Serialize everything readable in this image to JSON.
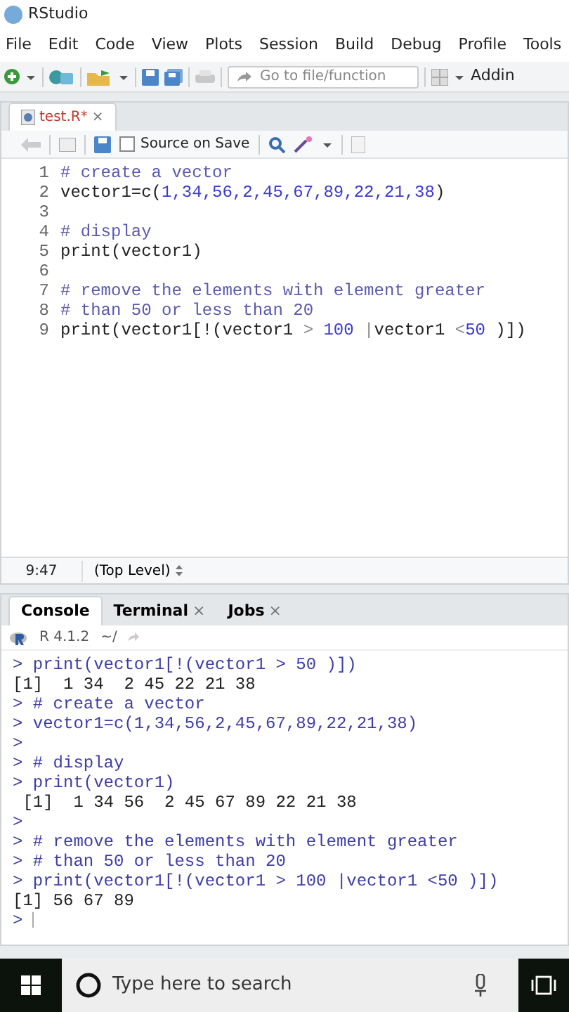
{
  "window": {
    "title": "RStudio"
  },
  "menu": [
    "File",
    "Edit",
    "Code",
    "View",
    "Plots",
    "Session",
    "Build",
    "Debug",
    "Profile",
    "Tools"
  ],
  "toolbar": {
    "goto_placeholder": "Go to file/function",
    "addins": "Addin"
  },
  "editor": {
    "tabs": [
      {
        "label": "test.R*",
        "selected": true,
        "modified": true,
        "close": "×"
      }
    ],
    "source_on_save": {
      "label": "Source on Save",
      "checked": false
    },
    "lines": [
      {
        "number": "1",
        "tokens": [
          {
            "text": "# create a vector",
            "kind": "comment"
          }
        ]
      },
      {
        "number": "2",
        "tokens": [
          {
            "text": "vector1=c(",
            "kind": "plain"
          },
          {
            "text": "1,34,56,2,45,67,89,22,21,38",
            "kind": "number"
          },
          {
            "text": ")",
            "kind": "plain"
          }
        ]
      },
      {
        "number": "3"
      },
      {
        "number": "4",
        "tokens": [
          {
            "text": "# display",
            "kind": "comment"
          }
        ]
      },
      {
        "number": "5",
        "tokens": [
          {
            "text": "print(vector1)",
            "kind": "plain"
          }
        ]
      },
      {
        "number": "6"
      },
      {
        "number": "7",
        "tokens": [
          {
            "text": "# remove the elements with element greater",
            "kind": "comment"
          }
        ]
      },
      {
        "number": "8",
        "tokens": [
          {
            "text": "# than 50 or less than 20",
            "kind": "comment"
          }
        ]
      },
      {
        "number": "9",
        "tokens": [
          {
            "text": "print(vector1[!(vector1 ",
            "kind": "plain"
          },
          {
            "text": ">",
            "kind": "op"
          },
          {
            "text": " 100",
            "kind": "number"
          },
          {
            "text": " |",
            "kind": "op"
          },
          {
            "text": "vector1 ",
            "kind": "plain"
          },
          {
            "text": "<",
            "kind": "op"
          },
          {
            "text": "50",
            "kind": "number"
          },
          {
            "text": " )])",
            "kind": "plain"
          }
        ]
      }
    ],
    "status": {
      "position": "9:47",
      "scope": "(Top Level)"
    }
  },
  "console": {
    "tabs": [
      {
        "label": "Console",
        "selected": true
      },
      {
        "label": "Terminal",
        "selected": false,
        "close": "×"
      },
      {
        "label": "Jobs",
        "selected": false,
        "close": "×"
      }
    ],
    "version": "R 4.1.2",
    "path": "~/",
    "lines": [
      {
        "text": "> print(vector1[!(vector1 > 50 )])",
        "kind": "input"
      },
      {
        "text": "[1]  1 34  2 45 22 21 38",
        "kind": "output"
      },
      {
        "text": "> # create a vector",
        "kind": "input"
      },
      {
        "text": "> vector1=c(1,34,56,2,45,67,89,22,21,38)",
        "kind": "input"
      },
      {
        "text": ">",
        "kind": "input"
      },
      {
        "text": "> # display",
        "kind": "input"
      },
      {
        "text": "> print(vector1)",
        "kind": "input"
      },
      {
        "text": " [1]  1 34 56  2 45 67 89 22 21 38",
        "kind": "output"
      },
      {
        "text": ">",
        "kind": "input"
      },
      {
        "text": "> # remove the elements with element greater",
        "kind": "input"
      },
      {
        "text": "> # than 50 or less than 20",
        "kind": "input"
      },
      {
        "text": "> print(vector1[!(vector1 > 100 |vector1 <50 )])",
        "kind": "input"
      },
      {
        "text": "[1] 56 67 89",
        "kind": "output"
      },
      {
        "text": ">",
        "kind": "prompt"
      }
    ]
  },
  "taskbar": {
    "search_placeholder": "Type here to search"
  }
}
